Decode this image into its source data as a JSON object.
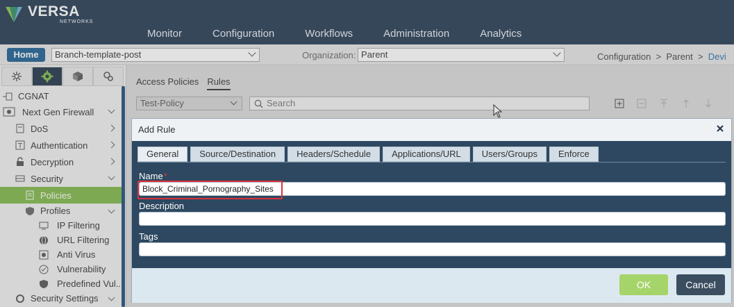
{
  "brand": {
    "name": "VERSA",
    "sub": "NETWORKS"
  },
  "mainnav": [
    "Monitor",
    "Configuration",
    "Workflows",
    "Administration",
    "Analytics"
  ],
  "subbar": {
    "home": "Home",
    "template": "Branch-template-post",
    "org_label": "Organization:",
    "org_value": "Parent",
    "breadcrumb": {
      "a": "Configuration",
      "sep1": ">",
      "b": "Parent",
      "sep2": ">",
      "c": "Devi"
    }
  },
  "sidebar": {
    "tabs": [
      "settings-icon",
      "gear-icon",
      "cube-icon",
      "services-icon"
    ],
    "items": [
      {
        "label": "CGNAT"
      },
      {
        "label": "Next Gen Firewall"
      },
      {
        "label": "DoS"
      },
      {
        "label": "Authentication"
      },
      {
        "label": "Decryption"
      },
      {
        "label": "Security"
      },
      {
        "label": "Policies"
      },
      {
        "label": "Profiles"
      },
      {
        "label": "IP Filtering"
      },
      {
        "label": "URL Filtering"
      },
      {
        "label": "Anti Virus"
      },
      {
        "label": "Vulnerability"
      },
      {
        "label": "Predefined Vul..."
      },
      {
        "label": "Security Settings"
      }
    ]
  },
  "content": {
    "tabs": [
      "Access Policies",
      "Rules"
    ],
    "policy": "Test-Policy",
    "search_placeholder": "Search"
  },
  "modal": {
    "title": "Add Rule",
    "tabs": [
      "General",
      "Source/Destination",
      "Headers/Schedule",
      "Applications/URL",
      "Users/Groups",
      "Enforce"
    ],
    "name_label": "Name",
    "required_mark": "*",
    "name_value": "Block_Criminal_Pornography_Sites",
    "description_label": "Description",
    "description_value": "",
    "tags_label": "Tags",
    "tags_value": "",
    "ok": "OK",
    "cancel": "Cancel"
  },
  "colors": {
    "header": "#243a52",
    "accent": "#1d5f93",
    "active_green": "#7fb84a",
    "modal_bg": "#2d4860",
    "highlight": "#d9333b"
  }
}
